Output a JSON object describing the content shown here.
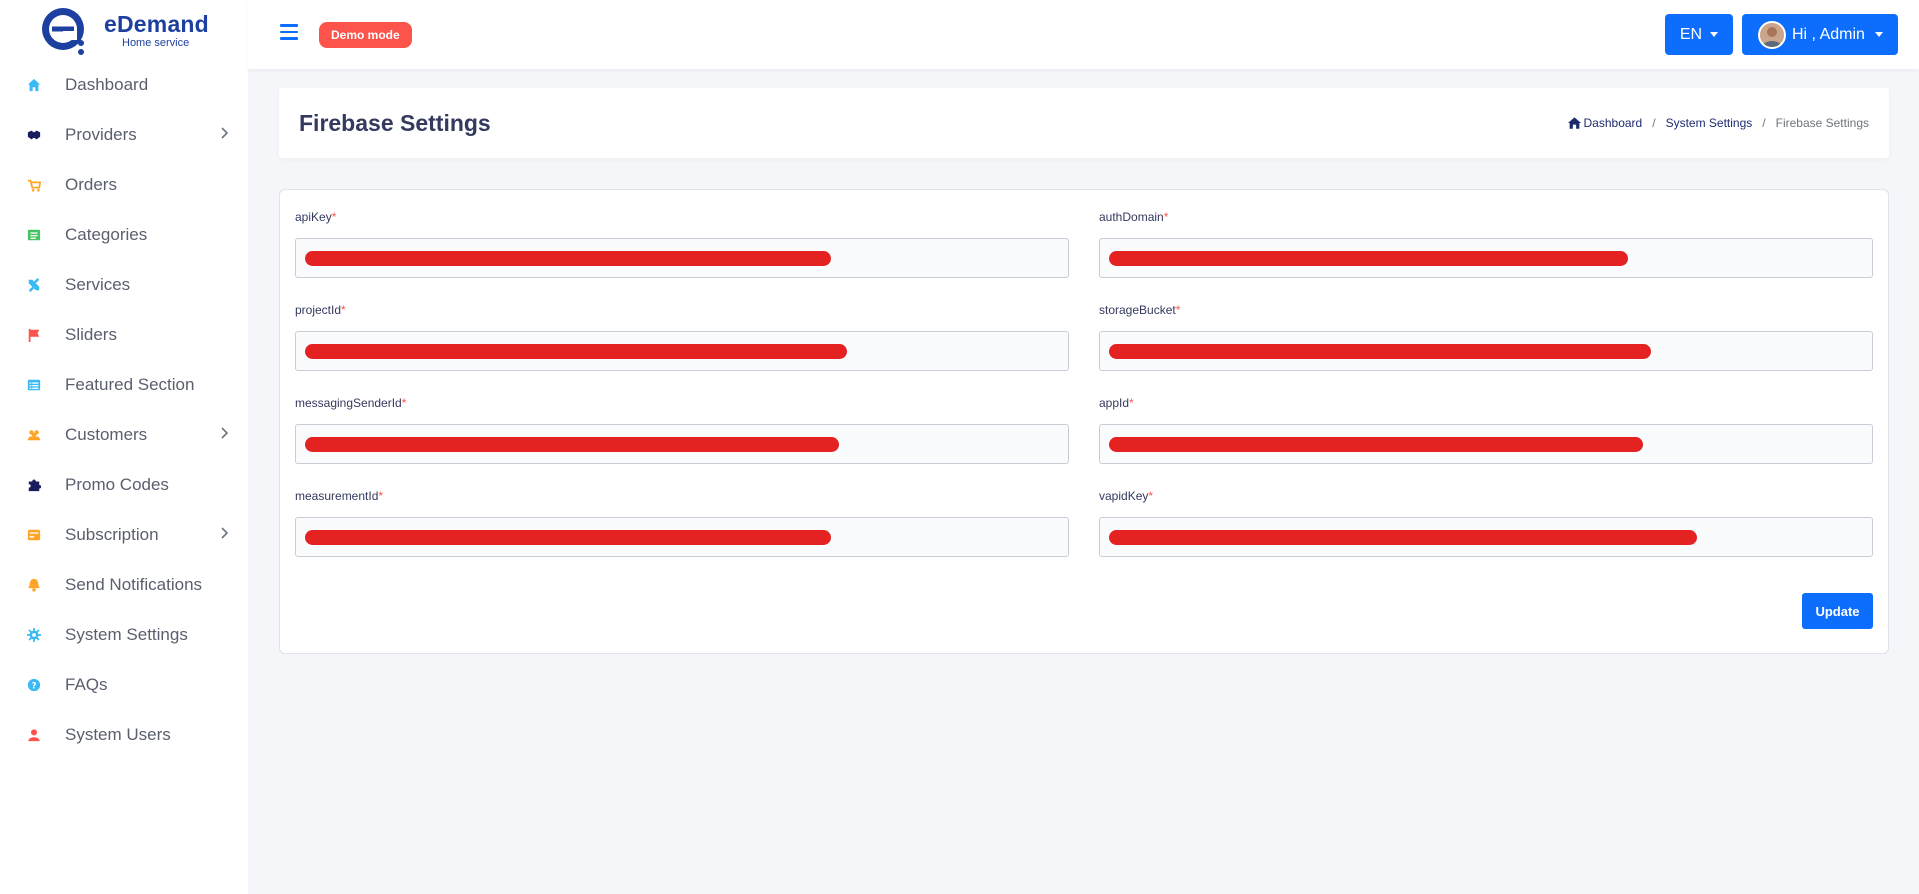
{
  "brand": {
    "name": "eDemand",
    "subtitle": "Home service"
  },
  "sidebar": {
    "items": [
      {
        "label": "Dashboard",
        "icon": "home-icon",
        "color": "#3abaf4",
        "has_submenu": false
      },
      {
        "label": "Providers",
        "icon": "handshake-icon",
        "color": "#191d5c",
        "has_submenu": true
      },
      {
        "label": "Orders",
        "icon": "cart-icon",
        "color": "#ffa426",
        "has_submenu": false
      },
      {
        "label": "Categories",
        "icon": "list-icon",
        "color": "#47c363",
        "has_submenu": false
      },
      {
        "label": "Services",
        "icon": "tools-icon",
        "color": "#3abaf4",
        "has_submenu": false
      },
      {
        "label": "Sliders",
        "icon": "flag-icon",
        "color": "#fc544b",
        "has_submenu": false
      },
      {
        "label": "Featured Section",
        "icon": "list-alt-icon",
        "color": "#3abaf4",
        "has_submenu": false
      },
      {
        "label": "Customers",
        "icon": "users-icon",
        "color": "#ffa426",
        "has_submenu": true
      },
      {
        "label": "Promo Codes",
        "icon": "puzzle-icon",
        "color": "#191d5c",
        "has_submenu": false
      },
      {
        "label": "Subscription",
        "icon": "card-icon",
        "color": "#ffa426",
        "has_submenu": true
      },
      {
        "label": "Send Notifications",
        "icon": "bell-icon",
        "color": "#ffa426",
        "has_submenu": false
      },
      {
        "label": "System Settings",
        "icon": "gear-icon",
        "color": "#3abaf4",
        "has_submenu": false
      },
      {
        "label": "FAQs",
        "icon": "question-circle-icon",
        "color": "#3abaf4",
        "has_submenu": false
      },
      {
        "label": "System Users",
        "icon": "user-icon",
        "color": "#fc544b",
        "has_submenu": false
      }
    ]
  },
  "navbar": {
    "demo_badge": "Demo mode",
    "language": "EN",
    "user_greeting": "Hi , Admin"
  },
  "page": {
    "title": "Firebase Settings",
    "breadcrumb": {
      "home": "Dashboard",
      "parent": "System Settings",
      "current": "Firebase Settings",
      "separator": "/"
    }
  },
  "form": {
    "fields": [
      {
        "label": "apiKey",
        "value": "",
        "redaction_fraction": 0.68
      },
      {
        "label": "authDomain",
        "value": "",
        "redaction_fraction": 0.67
      },
      {
        "label": "projectId",
        "value": "",
        "redaction_fraction": 0.7
      },
      {
        "label": "storageBucket",
        "value": "",
        "redaction_fraction": 0.7
      },
      {
        "label": "messagingSenderId",
        "value": "",
        "redaction_fraction": 0.69
      },
      {
        "label": "appId",
        "value": "",
        "redaction_fraction": 0.69
      },
      {
        "label": "measurementId",
        "value": "",
        "redaction_fraction": 0.68
      },
      {
        "label": "vapidKey",
        "value": "",
        "redaction_fraction": 0.76
      }
    ],
    "required_marker": "*",
    "submit_label": "Update"
  },
  "colors": {
    "primary": "#0d6efd",
    "danger": "#fc544b",
    "redaction": "#e42222",
    "brand": "#1d3f9f"
  }
}
